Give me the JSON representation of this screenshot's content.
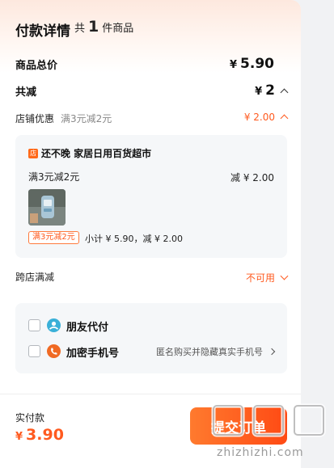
{
  "header": {
    "title": "付款详情",
    "count_prefix": "共",
    "count": "1",
    "count_suffix": "件商品"
  },
  "summary": {
    "total_label": "商品总价",
    "currency": "¥",
    "total_value": "5.90",
    "discount_label": "共减",
    "discount_value": "2"
  },
  "store_promo": {
    "label": "店铺优惠",
    "detail": "满3元减2元",
    "amount": "¥ 2.00"
  },
  "shop": {
    "name": "还不晚 家居日用百货超市",
    "badge_glyph": "店",
    "promo_text": "满3元减2元",
    "discount_text": "减 ¥ 2.00",
    "tag": "满3元减2元",
    "subtotal_text": "小计 ¥ 5.90，减 ¥ 2.00"
  },
  "cross_store": {
    "label": "跨店满减",
    "status": "不可用"
  },
  "payment_options": {
    "friend_pay_label": "朋友代付",
    "encrypted_phone_label": "加密手机号",
    "encrypted_phone_hint": "匿名购买并隐藏真实手机号"
  },
  "footer": {
    "paid_label": "实付款",
    "paid_value": "3.90",
    "submit_label": "提交订单",
    "watermark": "zhizhizhi.com"
  },
  "colors": {
    "accent": "#ff5a1f",
    "friend_icon": "#3ab0d8",
    "phone_icon": "#f06a24"
  }
}
